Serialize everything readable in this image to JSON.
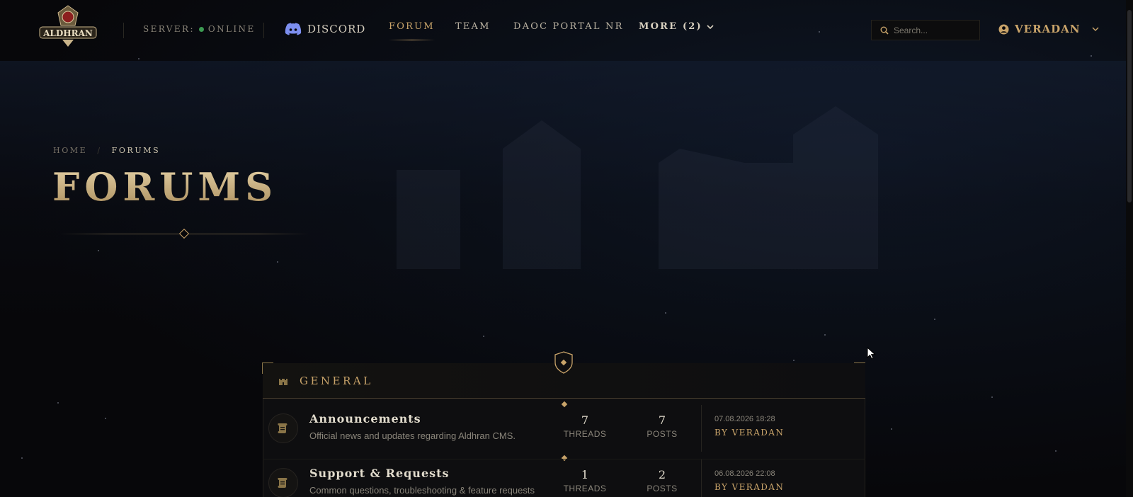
{
  "header": {
    "logo_text": "ALDHRAN",
    "server_label": "SERVER:",
    "server_status": "ONLINE",
    "nav": {
      "discord": "DISCORD",
      "forum": "FORUM",
      "team": "TEAM",
      "portal": "DAOC PORTAL NR",
      "more": "MORE (2)"
    },
    "search_placeholder": "Search...",
    "user": "VERADAN"
  },
  "hero": {
    "breadcrumb": {
      "home": "HOME",
      "separator": "/",
      "current": "FORUMS"
    },
    "title": "FORUMS"
  },
  "category": {
    "title": "GENERAL",
    "forums": [
      {
        "name": "Announcements",
        "description": "Official news and updates regarding Aldhran CMS.",
        "threads": "7",
        "threads_label": "THREADS",
        "posts": "7",
        "posts_label": "POSTS",
        "last_date": "07.08.2026 18:28",
        "last_by": "BY VERADAN"
      },
      {
        "name": "Support & Requests",
        "description": "Common questions, troubleshooting & feature requests",
        "threads": "1",
        "threads_label": "THREADS",
        "posts": "2",
        "posts_label": "POSTS",
        "last_date": "06.08.2026 22:08",
        "last_by": "BY VERADAN"
      }
    ]
  },
  "colors": {
    "accent": "#c9a46a",
    "status_online": "#3c9a52",
    "background": "#07070a"
  },
  "icons": [
    "discord-icon",
    "chevron-down-icon",
    "search-icon",
    "user-icon",
    "castle-icon",
    "shield-icon",
    "scroll-icon"
  ]
}
